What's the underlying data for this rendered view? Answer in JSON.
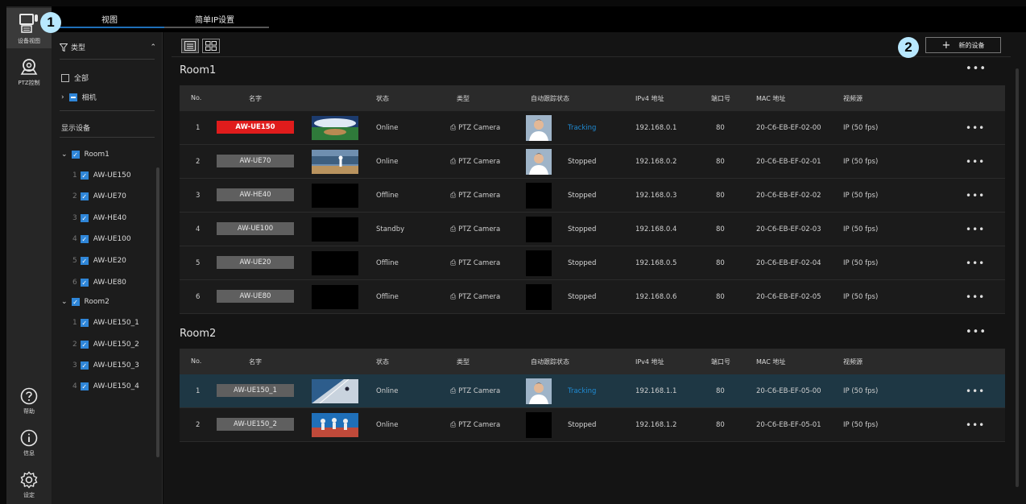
{
  "rail": [
    {
      "key": "device",
      "label": "设备视图",
      "icon": "camera-mic-icon"
    },
    {
      "key": "ptz",
      "label": "PTZ控制",
      "icon": "ptz-camera-icon"
    },
    {
      "key": "help",
      "label": "帮助",
      "icon": "help-icon"
    },
    {
      "key": "info",
      "label": "信息",
      "icon": "info-icon"
    },
    {
      "key": "settings",
      "label": "设定",
      "icon": "gear-icon"
    }
  ],
  "tabs": {
    "view": "视图",
    "simple_ip": "简单IP设置"
  },
  "badges": {
    "one": "1",
    "two": "2"
  },
  "sidebar": {
    "filter_label": "类型",
    "all_label": "全部",
    "camera_label": "相机",
    "display_devices": "显示设备",
    "groups": [
      {
        "name": "Room1",
        "items": [
          "AW-UE150",
          "AW-UE70",
          "AW-HE40",
          "AW-UE100",
          "AW-UE20",
          "AW-UE80"
        ]
      },
      {
        "name": "Room2",
        "items": [
          "AW-UE150_1",
          "AW-UE150_2",
          "AW-UE150_3",
          "AW-UE150_4"
        ]
      }
    ]
  },
  "toolbar": {
    "new_device": "新的设备"
  },
  "headers": {
    "no": "No.",
    "name": "名字",
    "status": "状态",
    "type": "类型",
    "tracking": "自动跟踪状态",
    "ipv4": "IPv4 地址",
    "port": "端口号",
    "mac": "MAC 地址",
    "source": "视频源"
  },
  "rooms": [
    {
      "title": "Room1",
      "rows": [
        {
          "no": "1",
          "name": "AW-UE150",
          "status": "Online",
          "type": "PTZ Camera",
          "tracking": "Tracking",
          "ip": "192.168.0.1",
          "port": "80",
          "mac": "20-C6-EB-EF-02-00",
          "source": "IP (50 fps)",
          "highlight": true,
          "thumb": "stadium",
          "face": true
        },
        {
          "no": "2",
          "name": "AW-UE70",
          "status": "Online",
          "type": "PTZ Camera",
          "tracking": "Stopped",
          "ip": "192.168.0.2",
          "port": "80",
          "mac": "20-C6-EB-EF-02-01",
          "source": "IP (50 fps)",
          "highlight": false,
          "thumb": "baseball",
          "face": true
        },
        {
          "no": "3",
          "name": "AW-HE40",
          "status": "Offline",
          "type": "PTZ Camera",
          "tracking": "Stopped",
          "ip": "192.168.0.3",
          "port": "80",
          "mac": "20-C6-EB-EF-02-02",
          "source": "IP (50 fps)",
          "highlight": false,
          "thumb": "none",
          "face": false
        },
        {
          "no": "4",
          "name": "AW-UE100",
          "status": "Standby",
          "type": "PTZ Camera",
          "tracking": "Stopped",
          "ip": "192.168.0.4",
          "port": "80",
          "mac": "20-C6-EB-EF-02-03",
          "source": "IP (50 fps)",
          "highlight": false,
          "thumb": "none",
          "face": false
        },
        {
          "no": "5",
          "name": "AW-UE20",
          "status": "Offline",
          "type": "PTZ Camera",
          "tracking": "Stopped",
          "ip": "192.168.0.5",
          "port": "80",
          "mac": "20-C6-EB-EF-02-04",
          "source": "IP (50 fps)",
          "highlight": false,
          "thumb": "none",
          "face": false
        },
        {
          "no": "6",
          "name": "AW-UE80",
          "status": "Offline",
          "type": "PTZ Camera",
          "tracking": "Stopped",
          "ip": "192.168.0.6",
          "port": "80",
          "mac": "20-C6-EB-EF-02-05",
          "source": "IP (50 fps)",
          "highlight": false,
          "thumb": "none",
          "face": false
        }
      ]
    },
    {
      "title": "Room2",
      "rows": [
        {
          "no": "1",
          "name": "AW-UE150_1",
          "status": "Online",
          "type": "PTZ Camera",
          "tracking": "Tracking",
          "ip": "192.168.1.1",
          "port": "80",
          "mac": "20-C6-EB-EF-05-00",
          "source": "IP (50 fps)",
          "highlight": false,
          "thumb": "track",
          "face": true,
          "selected": true
        },
        {
          "no": "2",
          "name": "AW-UE150_2",
          "status": "Online",
          "type": "PTZ Camera",
          "tracking": "Stopped",
          "ip": "192.168.1.2",
          "port": "80",
          "mac": "20-C6-EB-EF-05-01",
          "source": "IP (50 fps)",
          "highlight": false,
          "thumb": "runners",
          "face": false
        }
      ]
    }
  ],
  "colors": {
    "accent": "#2f86d8",
    "live": "#e01c1c",
    "tracking": "#1f8bd4",
    "selected_row": "#1e3744"
  }
}
